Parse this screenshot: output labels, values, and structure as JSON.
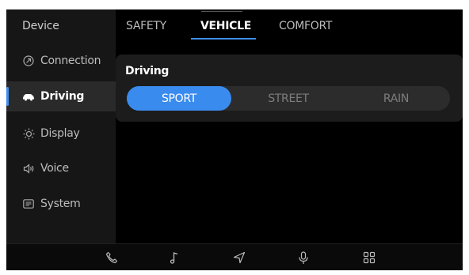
{
  "sidebar": {
    "title": "Device",
    "items": [
      {
        "label": "Connection",
        "icon": "connection-icon",
        "active": false
      },
      {
        "label": "Driving",
        "icon": "car-icon",
        "active": true
      },
      {
        "label": "Display",
        "icon": "brightness-icon",
        "active": false
      },
      {
        "label": "Voice",
        "icon": "speaker-icon",
        "active": false
      },
      {
        "label": "System",
        "icon": "system-icon",
        "active": false
      }
    ]
  },
  "tabs": [
    {
      "label": "SAFETY",
      "active": false
    },
    {
      "label": "VEHICLE",
      "active": true
    },
    {
      "label": "COMFORT",
      "active": false
    }
  ],
  "driving_card": {
    "title": "Driving",
    "modes": [
      "SPORT",
      "STREET",
      "RAIN"
    ],
    "selected": "SPORT"
  },
  "dock": {
    "icons": [
      "phone-icon",
      "music-icon",
      "navigation-icon",
      "microphone-icon",
      "apps-grid-icon"
    ]
  },
  "colors": {
    "accent": "#3a8bee",
    "background": "#000000",
    "sidebar": "#161616",
    "card": "#1c1c1c"
  }
}
